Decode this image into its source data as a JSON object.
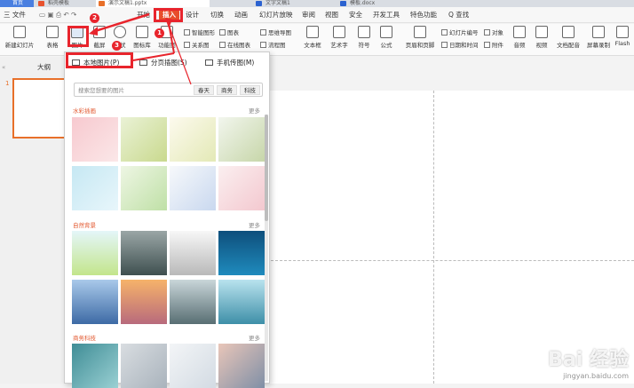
{
  "tabs": [
    {
      "label": "首页",
      "color": "#3b6fd8"
    },
    {
      "label": "稻壳模板",
      "color": "#e8532f"
    },
    {
      "label": "演示文稿1.pptx",
      "color": "#e8702a"
    },
    {
      "label": "文字文稿1",
      "color": "#2b62d0"
    },
    {
      "label": "模板.docx",
      "color": "#2b62d0"
    }
  ],
  "menu": {
    "file": "三 文件",
    "items": [
      "开始",
      "插入",
      "设计",
      "切换",
      "动画",
      "幻灯片放映",
      "审阅",
      "视图",
      "安全",
      "开发工具",
      "特色功能"
    ],
    "search": "Q 查找"
  },
  "ribbon": {
    "new_slide": "新建幻灯片",
    "table": "表格",
    "picture": "图片",
    "screenshot": "截屏",
    "shape": "形状",
    "icon_lib": "图标库",
    "func_chart": "功能图",
    "smart_shape": "智能图形",
    "chart": "图表",
    "relation": "关系图",
    "online_chart": "在线图表",
    "mindmap": "思维导图",
    "flowchart": "流程图",
    "textbox": "文本框",
    "art": "艺术字",
    "symbol": "符号",
    "formula": "公式",
    "header_footer": "页眉和页脚",
    "slide_number": "幻灯片编号",
    "object": "对象",
    "datetime": "日期和时间",
    "attachment": "附件",
    "audio": "音频",
    "video": "视频",
    "doc_voice": "文档配音",
    "screen_rec": "屏幕录制",
    "flash": "Flash"
  },
  "left_pane": {
    "label": "大纲",
    "slide_no": "1"
  },
  "dropdown": {
    "local": "本地图片(P)",
    "paged": "分页插图(S)",
    "phone": "手机传图(M)",
    "search_placeholder": "搜索您想要的图片",
    "chips": [
      "春天",
      "商务",
      "科技"
    ],
    "sections": [
      {
        "title": "水彩插画",
        "more": "更多"
      },
      {
        "title": "自然背景",
        "more": "更多"
      },
      {
        "title": "商务科技",
        "more": "更多"
      }
    ]
  },
  "badges": [
    "1",
    "2",
    "3"
  ],
  "watermark": {
    "line1": "Bai 经验",
    "line2": "jingyan.baidu.com"
  }
}
